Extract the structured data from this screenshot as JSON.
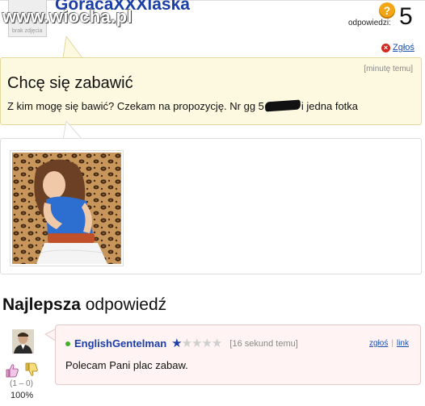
{
  "header": {
    "username": "GoracaXXXlaska",
    "watermark": "www.wiocha.pl",
    "avatar_label": "brak zdjęcia",
    "answers_label": "odpowiedzi:",
    "answers_count": "5",
    "question_icon": "?",
    "report_label": "Zgłoś"
  },
  "question": {
    "time": "[minutę temu]",
    "title": "Chcę się zabawić",
    "body_before": "Z kim mogę się bawić? Czekam na propozycję. Nr gg 5",
    "body_after": "i jedna fotka"
  },
  "best_answer": {
    "heading_bold": "Najlepsza",
    "heading_rest": " odpowiedź",
    "user": "EnglishGentelman",
    "stars_on": "★",
    "stars_off": "★★★★",
    "time": "[16 sekund temu]",
    "report_link": "zgłoś",
    "link_link": "link",
    "separator": "|",
    "text": "Polecam Pani plac zabaw.",
    "votes": "(1 – 0)",
    "percent": "100%"
  },
  "colors": {
    "username": "#1b3fa6",
    "question_bg": "#fdf8e0",
    "answer_bg": "#fff3f3",
    "link": "#1a4fb0"
  }
}
